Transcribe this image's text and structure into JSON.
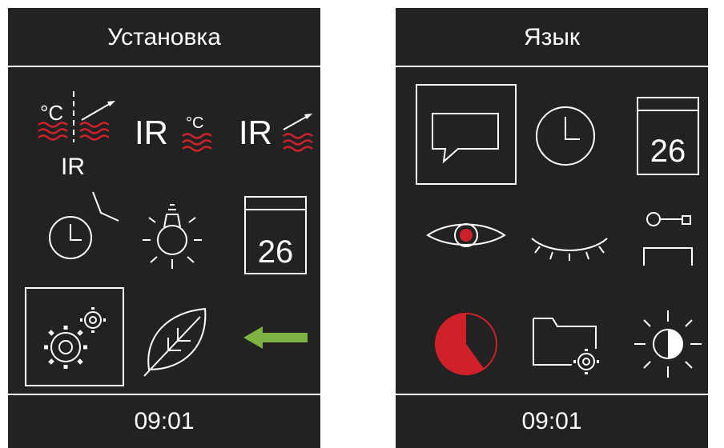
{
  "colors": {
    "background": "#222222",
    "foreground": "#ffffff",
    "heat_red": "#d0212b",
    "back_arrow": "#7cb342"
  },
  "screens": [
    {
      "title": "Установка",
      "footer_time": "09:01",
      "icons": [
        {
          "name": "sensor-calibration-icon",
          "labels": {
            "degree": "°C",
            "ir": "IR"
          }
        },
        {
          "name": "ir-temperature-icon",
          "labels": {
            "ir": "IR",
            "degree": "°C"
          }
        },
        {
          "name": "ir-rise-icon",
          "labels": {
            "ir": "IR"
          }
        },
        {
          "name": "clock-adjust-icon"
        },
        {
          "name": "light-bulb-icon"
        },
        {
          "name": "calendar-icon",
          "labels": {
            "day": "26"
          }
        },
        {
          "name": "gears-icon",
          "selected": true
        },
        {
          "name": "leaf-icon"
        },
        {
          "name": "back-arrow-icon"
        }
      ]
    },
    {
      "title": "Язык",
      "footer_time": "09:01",
      "icons": [
        {
          "name": "speech-bubble-icon",
          "selected": true
        },
        {
          "name": "clock-icon"
        },
        {
          "name": "calendar-icon",
          "labels": {
            "day": "26"
          }
        },
        {
          "name": "eye-open-icon"
        },
        {
          "name": "eye-closed-icon"
        },
        {
          "name": "key-lock-icon"
        },
        {
          "name": "pie-timer-icon",
          "fill_fraction": 0.6
        },
        {
          "name": "folder-settings-icon"
        },
        {
          "name": "brightness-icon"
        }
      ]
    }
  ]
}
